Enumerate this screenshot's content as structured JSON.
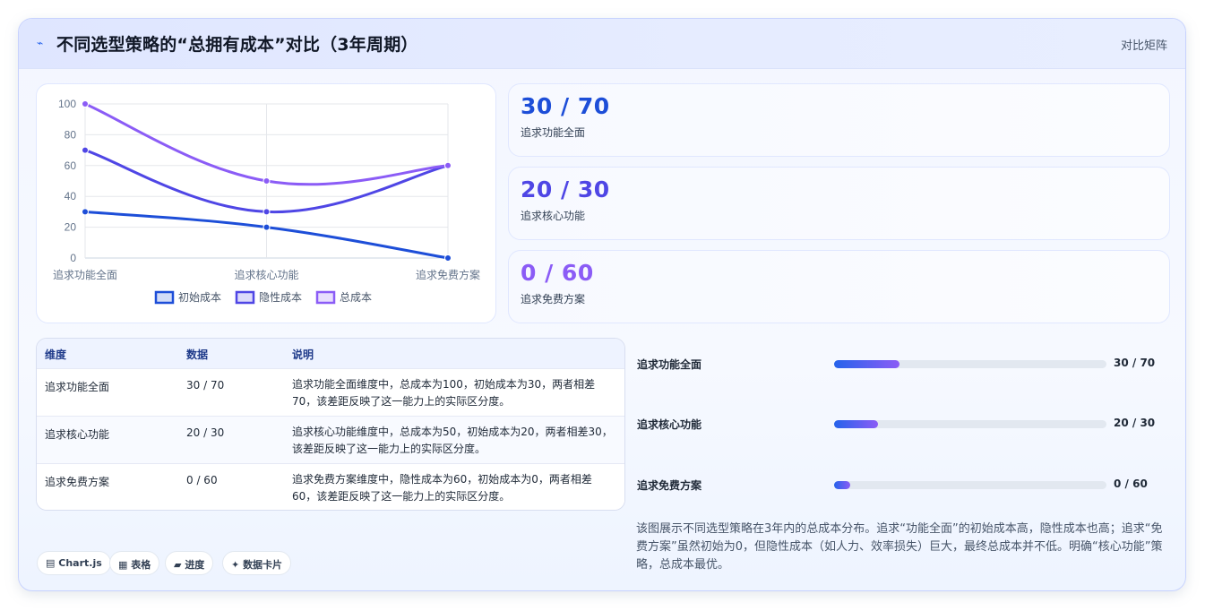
{
  "header": {
    "icon": "chart-line-icon",
    "title": "不同选型策略的“总拥有成本”对比（3年周期）",
    "tag": "对比矩阵"
  },
  "chart_data": {
    "type": "line",
    "categories": [
      "追求功能全面",
      "追求核心功能",
      "追求免费方案"
    ],
    "series": [
      {
        "name": "初始成本",
        "values": [
          30,
          20,
          0
        ],
        "color": "#1d4ed8"
      },
      {
        "name": "隐性成本",
        "values": [
          70,
          30,
          60
        ],
        "color": "#4f46e5"
      },
      {
        "name": "总成本",
        "values": [
          100,
          50,
          60
        ],
        "color": "#8b5cf6"
      }
    ],
    "yticks": [
      0,
      20,
      40,
      60,
      80,
      100
    ],
    "ylim": [
      0,
      100
    ],
    "legend": "bottom",
    "grid": true
  },
  "stats": [
    {
      "value": "30 / 70",
      "label": "追求功能全面",
      "color": "#1d4ed8"
    },
    {
      "value": "20 / 30",
      "label": "追求核心功能",
      "color": "#4f46e5"
    },
    {
      "value": "0 / 60",
      "label": "追求免费方案",
      "color": "#8b5cf6"
    }
  ],
  "table": {
    "headers": [
      "维度",
      "数据",
      "说明"
    ],
    "rows": [
      {
        "dim": "追求功能全面",
        "data": "30 / 70",
        "note": "追求功能全面维度中，总成本为100，初始成本为30，两者相差70，该差距反映了这一能力上的实际区分度。"
      },
      {
        "dim": "追求核心功能",
        "data": "20 / 30",
        "note": "追求核心功能维度中，总成本为50，初始成本为20，两者相差30，该差距反映了这一能力上的实际区分度。"
      },
      {
        "dim": "追求免费方案",
        "data": "0 / 60",
        "note": "追求免费方案维度中，隐性成本为60，初始成本为0，两者相差60，该差距反映了这一能力上的实际区分度。"
      }
    ]
  },
  "progress": [
    {
      "label": "追求功能全面",
      "value": "30 / 70",
      "fraction": 0.24
    },
    {
      "label": "追求核心功能",
      "value": "20 / 30",
      "fraction": 0.16
    },
    {
      "label": "追求免费方案",
      "value": "0 / 60",
      "fraction": 0.06
    }
  ],
  "description": "该图展示不同选型策略在3年内的总成本分布。追求“功能全面”的初始成本高，隐性成本也高；追求“免费方案”虽然初始为0，但隐性成本（如人力、效率损失）巨大，最终总成本并不低。明确“核心功能”策略，总成本最优。",
  "chips": [
    {
      "icon": "▤",
      "label": "Chart.js"
    },
    {
      "icon": "▦",
      "label": "表格"
    },
    {
      "icon": "▰",
      "label": "进度"
    },
    {
      "icon": "✦",
      "label": "数据卡片"
    }
  ]
}
